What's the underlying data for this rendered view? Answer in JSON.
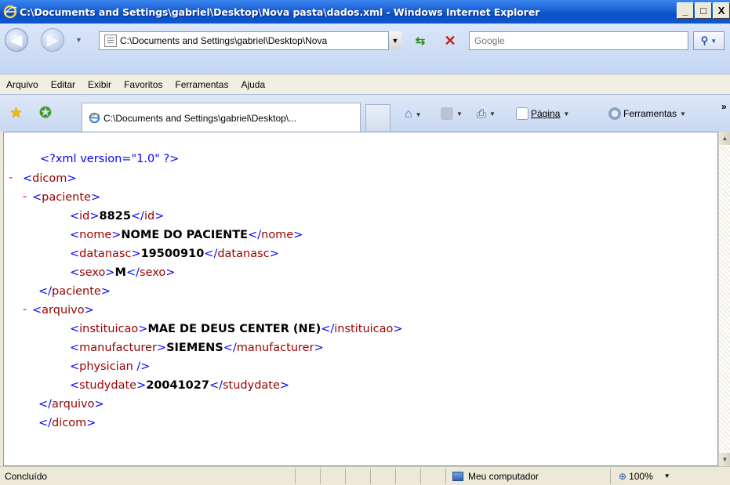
{
  "window": {
    "title": "C:\\Documents and Settings\\gabriel\\Desktop\\Nova pasta\\dados.xml - Windows Internet Explorer",
    "min_label": "_",
    "max_label": "□",
    "close_label": "X"
  },
  "address": {
    "url": "C:\\Documents and Settings\\gabriel\\Desktop\\Nova",
    "search_placeholder": "Google"
  },
  "menu": [
    "Arquivo",
    "Editar",
    "Exibir",
    "Favoritos",
    "Ferramentas",
    "Ajuda"
  ],
  "tab": {
    "label": "C:\\Documents and Settings\\gabriel\\Desktop\\..."
  },
  "commands": {
    "page": "Página",
    "tools": "Ferramentas",
    "more": "»"
  },
  "xml": {
    "decl": "<?xml version=\"1.0\" ?>",
    "minus": "-",
    "lines": [
      {
        "indent": 1,
        "open": "<dicom>"
      },
      {
        "indent": 2,
        "open": "<paciente>"
      },
      {
        "indent": 3,
        "open": "<id>",
        "value": "8825",
        "close": "</id>"
      },
      {
        "indent": 3,
        "open": "<nome>",
        "value": "NOME DO PACIENTE",
        "close": "</nome>"
      },
      {
        "indent": 3,
        "open": "<datanasc>",
        "value": "19500910",
        "close": "</datanasc>"
      },
      {
        "indent": 3,
        "open": "<sexo>",
        "value": "M",
        "close": "</sexo>"
      },
      {
        "indent": 2,
        "close": "</paciente>"
      },
      {
        "indent": 2,
        "open": "<arquivo>"
      },
      {
        "indent": 3,
        "open": "<instituicao>",
        "value": "MAE DE DEUS CENTER (NE)",
        "close": "</instituicao>"
      },
      {
        "indent": 3,
        "open": "<manufacturer>",
        "value": "SIEMENS",
        "close": "</manufacturer>"
      },
      {
        "indent": 3,
        "open": "<physician />"
      },
      {
        "indent": 3,
        "open": "<studydate>",
        "value": "20041027",
        "close": "</studydate>"
      },
      {
        "indent": 2,
        "close": "</arquivo>"
      },
      {
        "indent": 1,
        "close": "</dicom>"
      }
    ]
  },
  "status": {
    "text": "Concluído",
    "zone": "Meu computador",
    "zoom": "100%"
  },
  "colors": {
    "tag": "#990000",
    "bracket": "#0000ff",
    "minus": "#ff0000",
    "titlebar": "#0a50c6"
  }
}
